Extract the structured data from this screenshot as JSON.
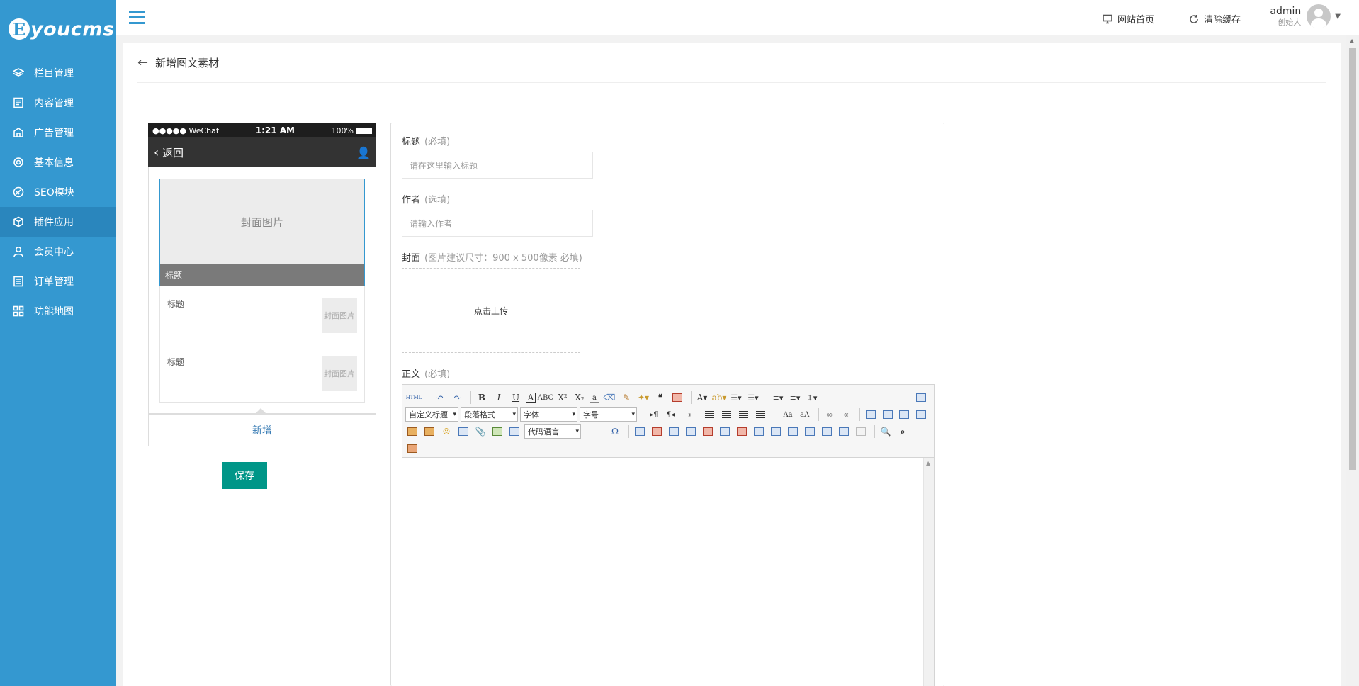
{
  "brand": {
    "mark": "E",
    "name": "youcms"
  },
  "sidebar": {
    "items": [
      {
        "label": "栏目管理",
        "icon": "layers-icon"
      },
      {
        "label": "内容管理",
        "icon": "document-icon"
      },
      {
        "label": "广告管理",
        "icon": "ad-icon"
      },
      {
        "label": "基本信息",
        "icon": "gear-icon"
      },
      {
        "label": "SEO模块",
        "icon": "seo-icon"
      },
      {
        "label": "插件应用",
        "icon": "cube-icon",
        "active": true
      },
      {
        "label": "会员中心",
        "icon": "user-icon"
      },
      {
        "label": "订单管理",
        "icon": "list-icon"
      },
      {
        "label": "功能地图",
        "icon": "grid-icon"
      }
    ]
  },
  "header": {
    "home_link": "网站首页",
    "clear_cache": "清除缓存",
    "user_name": "admin",
    "user_role": "创始人"
  },
  "page": {
    "title": "新增图文素材"
  },
  "phone": {
    "carrier": "●●●●● WeChat",
    "time": "1:21 AM",
    "battery": "100%",
    "back_label": "返回",
    "cover_placeholder": "封面图片",
    "cover_title": "标题",
    "sub_items": [
      {
        "title": "标题",
        "thumb": "封面图片"
      },
      {
        "title": "标题",
        "thumb": "封面图片"
      }
    ],
    "add_label": "新增",
    "save_label": "保存"
  },
  "form": {
    "title_label": "标题",
    "title_hint": "(必填)",
    "title_placeholder": "请在这里输入标题",
    "author_label": "作者",
    "author_hint": "(选填)",
    "author_placeholder": "请输入作者",
    "cover_label": "封面",
    "cover_hint": "(图片建议尺寸：900 x 500像素 必填)",
    "upload_label": "点击上传",
    "body_label": "正文",
    "body_hint": "(必填)"
  },
  "editor": {
    "html_label": "HTML",
    "select_custom_title": "自定义标题",
    "select_paragraph": "段落格式",
    "select_font": "字体",
    "select_size": "字号",
    "select_code_lang": "代码语言"
  },
  "colors": {
    "sidebar": "#3498d0",
    "accent": "#009688"
  }
}
